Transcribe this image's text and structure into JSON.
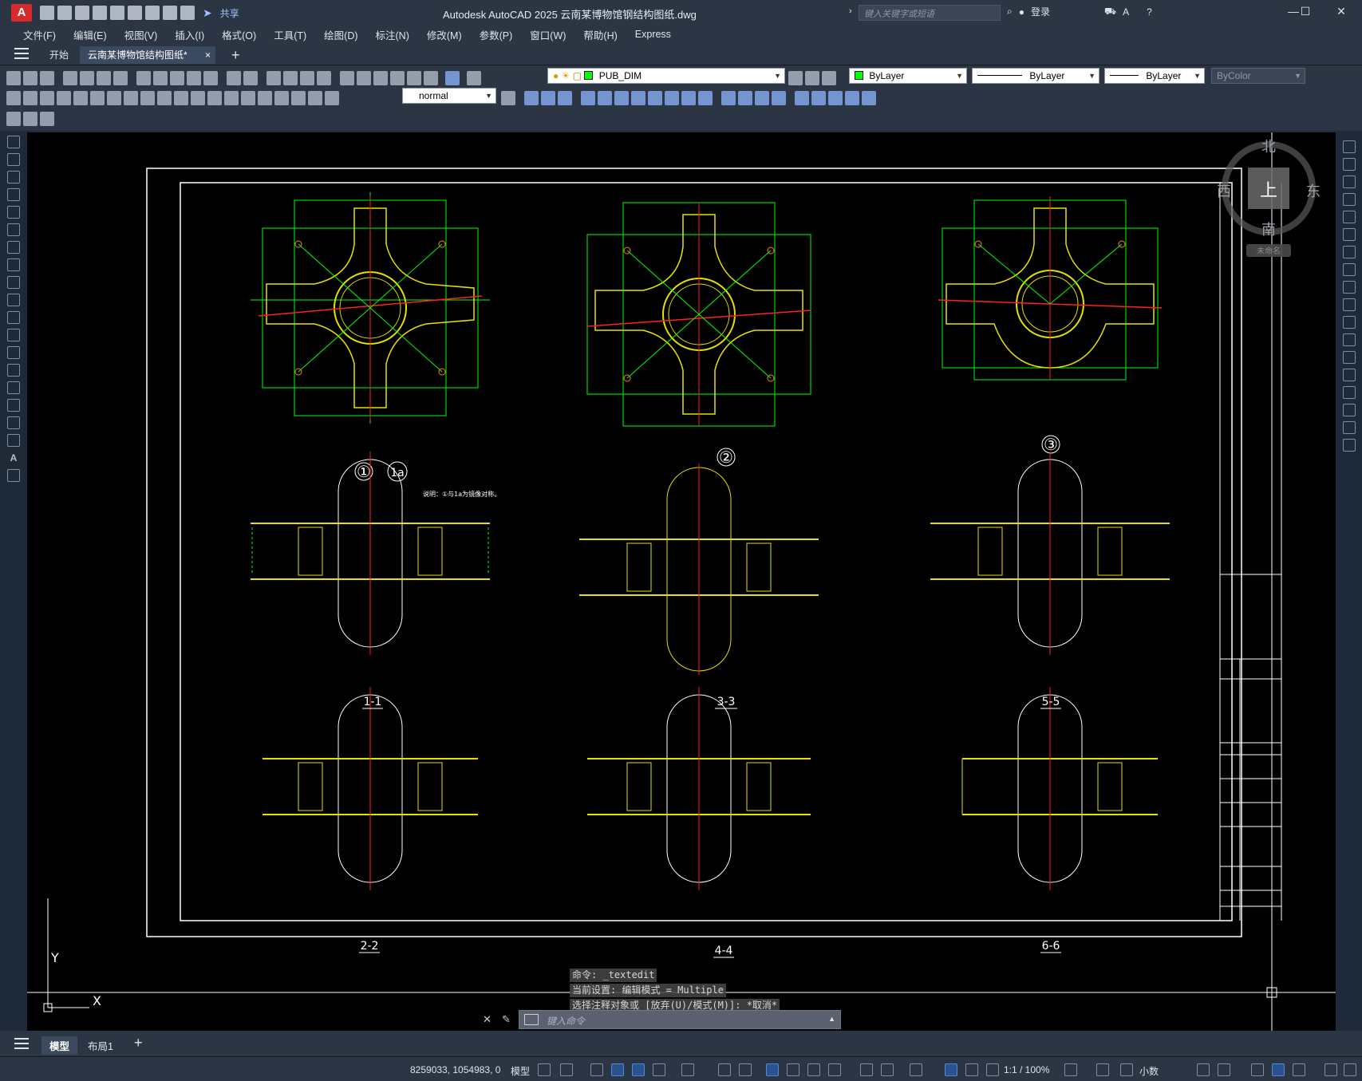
{
  "window": {
    "title": "Autodesk AutoCAD 2025    云南某博物馆钢结构图纸.dwg",
    "app_logo": "A",
    "share_label": "共享",
    "search_placeholder": "键入关键字或短语",
    "login_label": "登录"
  },
  "menu": [
    "文件(F)",
    "编辑(E)",
    "视图(V)",
    "插入(I)",
    "格式(O)",
    "工具(T)",
    "绘图(D)",
    "标注(N)",
    "修改(M)",
    "参数(P)",
    "窗口(W)",
    "帮助(H)",
    "Express"
  ],
  "tabs": {
    "start": "开始",
    "doc": "云南某博物馆结构图纸*",
    "close": "×",
    "add": "+"
  },
  "properties": {
    "layer": "PUB_DIM",
    "color": "ByLayer",
    "linetype": "ByLayer",
    "lineweight": "ByLayer",
    "plotstyle": "ByColor",
    "textstyle": "normal"
  },
  "viewcube": {
    "north": "北",
    "south": "南",
    "east": "东",
    "west": "西",
    "face": "上",
    "wcs": "未命名"
  },
  "drawing": {
    "plan_labels": [
      "①",
      "1a",
      "②",
      "③"
    ],
    "note": "说明：①与1a为镜像对称。",
    "section_labels": [
      "1-1",
      "3-3",
      "5-5",
      "2-2",
      "4-4",
      "6-6"
    ],
    "ucs_y": "Y",
    "ucs_x": "X"
  },
  "command": {
    "line1": "命令: _textedit",
    "line2": "当前设置: 编辑模式 = Multiple",
    "line3": "选择注释对象或 [放弃(U)/模式(M)]: *取消*",
    "placeholder": "键入命令"
  },
  "layout_tabs": {
    "model": "模型",
    "layout1": "布局1",
    "add": "+"
  },
  "status": {
    "coords": "8259033, 1054983, 0",
    "space": "模型",
    "scale": "1:1 / 100%",
    "units": "小数"
  }
}
